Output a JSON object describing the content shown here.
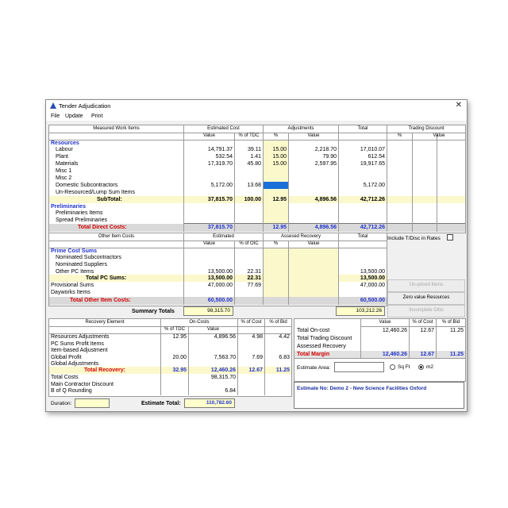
{
  "window": {
    "title": "Tender Adjudication"
  },
  "menu": [
    "File",
    "Update",
    "Print"
  ],
  "top": {
    "headers": {
      "measured": "Measured Work Items",
      "estimated": "Estimated Cost",
      "adjustments": "Adjustments",
      "total": "Total",
      "trading": "Trading Discount",
      "value": "Value",
      "pct_tdc": "% of TDC",
      "pct": "%"
    },
    "resources_heading": "Resources",
    "rows": [
      {
        "label": "Labour",
        "value": "14,791.37",
        "pct_tdc": "39.11",
        "adj_pct": "15.00",
        "adj_val": "2,218.70",
        "total": "17,010.07"
      },
      {
        "label": "Plant",
        "value": "532.54",
        "pct_tdc": "1.41",
        "adj_pct": "15.00",
        "adj_val": "79.90",
        "total": "612.54"
      },
      {
        "label": "Materials",
        "value": "17,319.70",
        "pct_tdc": "45.80",
        "adj_pct": "15.00",
        "adj_val": "2,597.95",
        "total": "19,917.65"
      },
      {
        "label": "Misc 1",
        "value": "",
        "pct_tdc": "",
        "adj_pct": "",
        "adj_val": "",
        "total": ""
      },
      {
        "label": "Misc 2",
        "value": "",
        "pct_tdc": "",
        "adj_pct": "",
        "adj_val": "",
        "total": ""
      },
      {
        "label": "Domestic Subcontractors",
        "value": "5,172.00",
        "pct_tdc": "13.68",
        "adj_pct": "",
        "adj_val": "",
        "total": "5,172.00"
      },
      {
        "label": "Un-Resourced/Lump Sum Items",
        "value": "",
        "pct_tdc": "",
        "adj_pct": "",
        "adj_val": "",
        "total": ""
      }
    ],
    "subtotal": {
      "label": "SubTotal:",
      "value": "37,815.70",
      "pct_tdc": "100.00",
      "adj_pct": "12.95",
      "adj_val": "4,896.56",
      "total": "42,712.26"
    },
    "prelims_heading": "Preliminaries",
    "prelims_items": [
      "Preliminaries Items",
      "Spread Preliminaries"
    ],
    "direct": {
      "label": "Total Direct Costs:",
      "value": "37,815.70",
      "adj_pct": "12.95",
      "adj_val": "4,896.56",
      "total": "42,712.26"
    }
  },
  "other": {
    "headers": {
      "other": "Other Item Costs",
      "estimated": "Estimated",
      "assessed": "Assesed Recovery",
      "total": "Total",
      "value": "Value",
      "pct_oic": "% of OIC",
      "pct": "%"
    },
    "prime_heading": "Prime Cost Sums",
    "rows": [
      {
        "label": "Nominated Subcontractors",
        "value": "",
        "pct": "",
        "total": ""
      },
      {
        "label": "Nominated Suppliers",
        "value": "",
        "pct": "",
        "total": ""
      },
      {
        "label": "Other PC Items",
        "value": "13,500.00",
        "pct": "22.31",
        "total": "13,500.00"
      }
    ],
    "pc_sums": {
      "label": "Total PC Sums:",
      "value": "13,500.00",
      "pct": "22.31",
      "total": "13,500.00"
    },
    "prov": {
      "label": "Provisional Sums",
      "value": "47,000.00",
      "pct": "77.69",
      "total": "47,000.00"
    },
    "dayworks": {
      "label": "Dayworks Items"
    },
    "total_other": {
      "label": "Total Other Item Costs:",
      "value": "60,500.00",
      "total": "60,500.00"
    },
    "include_label": "Include T/Disc in Rates"
  },
  "buttons": {
    "unpriced": "Un-priced Items",
    "zero": "Zero value Resources",
    "incomplete": "Incomplete Ditto"
  },
  "summary": {
    "label": "Summary Totals",
    "left": "98,315.70",
    "right": "103,212.26"
  },
  "recovery": {
    "headers": {
      "element": "Recovery Element",
      "oncosts": "On-Costs",
      "pct_tdc": "% of TDC",
      "value": "Value",
      "pct_cost": "% of Cost",
      "pct_bid": "% of Bid"
    },
    "rows": [
      {
        "label": "Resources Adjustments",
        "pct": "12.95",
        "value": "4,896.56",
        "pct_cost": "4.98",
        "pct_bid": "4.42"
      },
      {
        "label": "PC Sums Profit Items",
        "pct": "",
        "value": "",
        "pct_cost": "",
        "pct_bid": ""
      },
      {
        "label": "Item-based Adjustment",
        "pct": "",
        "value": "",
        "pct_cost": "",
        "pct_bid": ""
      },
      {
        "label": "Global Profit",
        "pct": "20.00",
        "value": "7,563.70",
        "pct_cost": "7.69",
        "pct_bid": "6.83"
      },
      {
        "label": "Global Adjustments",
        "pct": "",
        "value": "",
        "pct_cost": "",
        "pct_bid": ""
      }
    ],
    "total_recovery": {
      "label": "Total Recovery:",
      "pct": "32.95",
      "value": "12,460.26",
      "pct_cost": "12.67",
      "pct_bid": "11.25"
    },
    "total_costs": {
      "label": "Total Costs",
      "value": "98,315.70"
    },
    "main_discount": {
      "label": "Main Contractor Discount"
    },
    "rounding": {
      "label": "B of Q Rounding",
      "value": "6.84"
    },
    "duration_label": "Duration:",
    "estimate_total_label": "Estimate Total:",
    "estimate_total": "110,782.60"
  },
  "margin": {
    "headers": {
      "value": "Value",
      "pct_cost": "% of Cost",
      "pct_bid": "% of Bid"
    },
    "rows": [
      {
        "label": "Total On-cost",
        "value": "12,460.26",
        "pct_cost": "12.67",
        "pct_bid": "11.25"
      },
      {
        "label": "Total Trading Discount",
        "value": "",
        "pct_cost": "",
        "pct_bid": ""
      },
      {
        "label": "Assessed Recovery",
        "value": "",
        "pct_cost": "",
        "pct_bid": ""
      }
    ],
    "total_margin": {
      "label": "Total Margin",
      "value": "12,460.26",
      "pct_cost": "12.67",
      "pct_bid": "11.25"
    },
    "estimate_area_label": "Estimate Area:",
    "sqft": "Sq Ft",
    "m2": "m2",
    "estimate_info": "Estimate No: Demo 2 - New Science Facilities Oxford"
  },
  "colors": {
    "accent_blue": "#2233cc",
    "red": "#d40000",
    "yellow_band": "#fbf8cc",
    "selected": "#1a6fd8"
  }
}
